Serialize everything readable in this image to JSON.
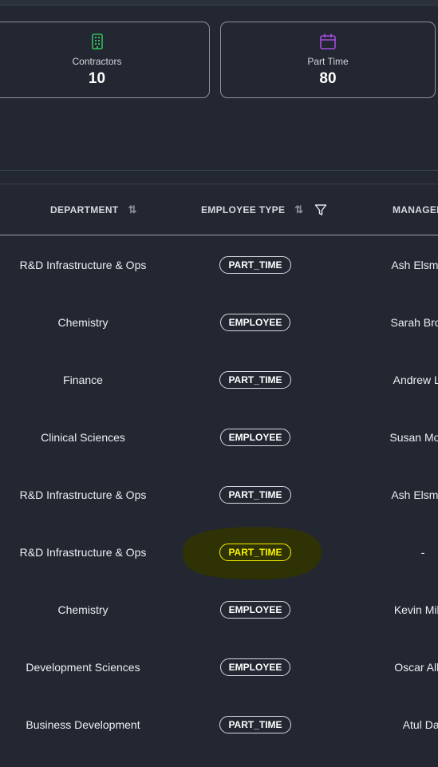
{
  "cards": [
    {
      "label": "Contractors",
      "value": "10",
      "icon": "building-icon",
      "color": "#2fbf5a"
    },
    {
      "label": "Part Time",
      "value": "80",
      "icon": "calendar-icon",
      "color": "#a24de0"
    }
  ],
  "table": {
    "columns": {
      "department": "DEPARTMENT",
      "employee_type": "EMPLOYEE TYPE",
      "manager": "MANAGER"
    },
    "rows": [
      {
        "department": "R&D Infrastructure & Ops",
        "type": "PART_TIME",
        "manager": "Ash Elsmore"
      },
      {
        "department": "Chemistry",
        "type": "EMPLOYEE",
        "manager": "Sarah Brown"
      },
      {
        "department": "Finance",
        "type": "PART_TIME",
        "manager": "Andrew Lee"
      },
      {
        "department": "Clinical Sciences",
        "type": "EMPLOYEE",
        "manager": "Susan Moore"
      },
      {
        "department": "R&D Infrastructure & Ops",
        "type": "PART_TIME",
        "manager": "Ash Elsmore"
      },
      {
        "department": "R&D Infrastructure & Ops",
        "type": "PART_TIME",
        "manager": "-"
      },
      {
        "department": "Chemistry",
        "type": "EMPLOYEE",
        "manager": "Kevin Miller"
      },
      {
        "department": "Development Sciences",
        "type": "EMPLOYEE",
        "manager": "Oscar Allen"
      },
      {
        "department": "Business Development",
        "type": "PART_TIME",
        "manager": "Atul Dar"
      }
    ]
  },
  "colors": {
    "highlight_marker": "#2f3205",
    "highlight_text": "#f5f200"
  }
}
